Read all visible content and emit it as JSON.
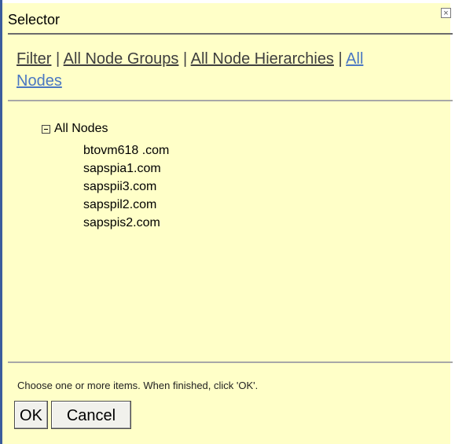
{
  "window": {
    "title": "Selector"
  },
  "nav": {
    "filter": "Filter",
    "all_node_groups": "All Node Groups",
    "all_node_hierarchies": "All Node Hierarchies",
    "all_nodes_line1": "All",
    "all_nodes_line2": "Nodes",
    "separator": "|"
  },
  "tree": {
    "root_label": "All Nodes",
    "items": [
      "btovm618 .com",
      "sapspia1.com",
      "sapspii3.com",
      "sapspil2.com",
      "sapspis2.com"
    ]
  },
  "footer": {
    "instruction": "Choose one or more items. When finished, click 'OK'.",
    "ok_label": "OK",
    "cancel_label": "Cancel"
  },
  "icons": {
    "close": "close-icon",
    "collapse": "minus-box-icon"
  },
  "colors": {
    "background": "#ffffc8",
    "link_active": "#4a77c2",
    "frame": "#3b5c9c"
  }
}
